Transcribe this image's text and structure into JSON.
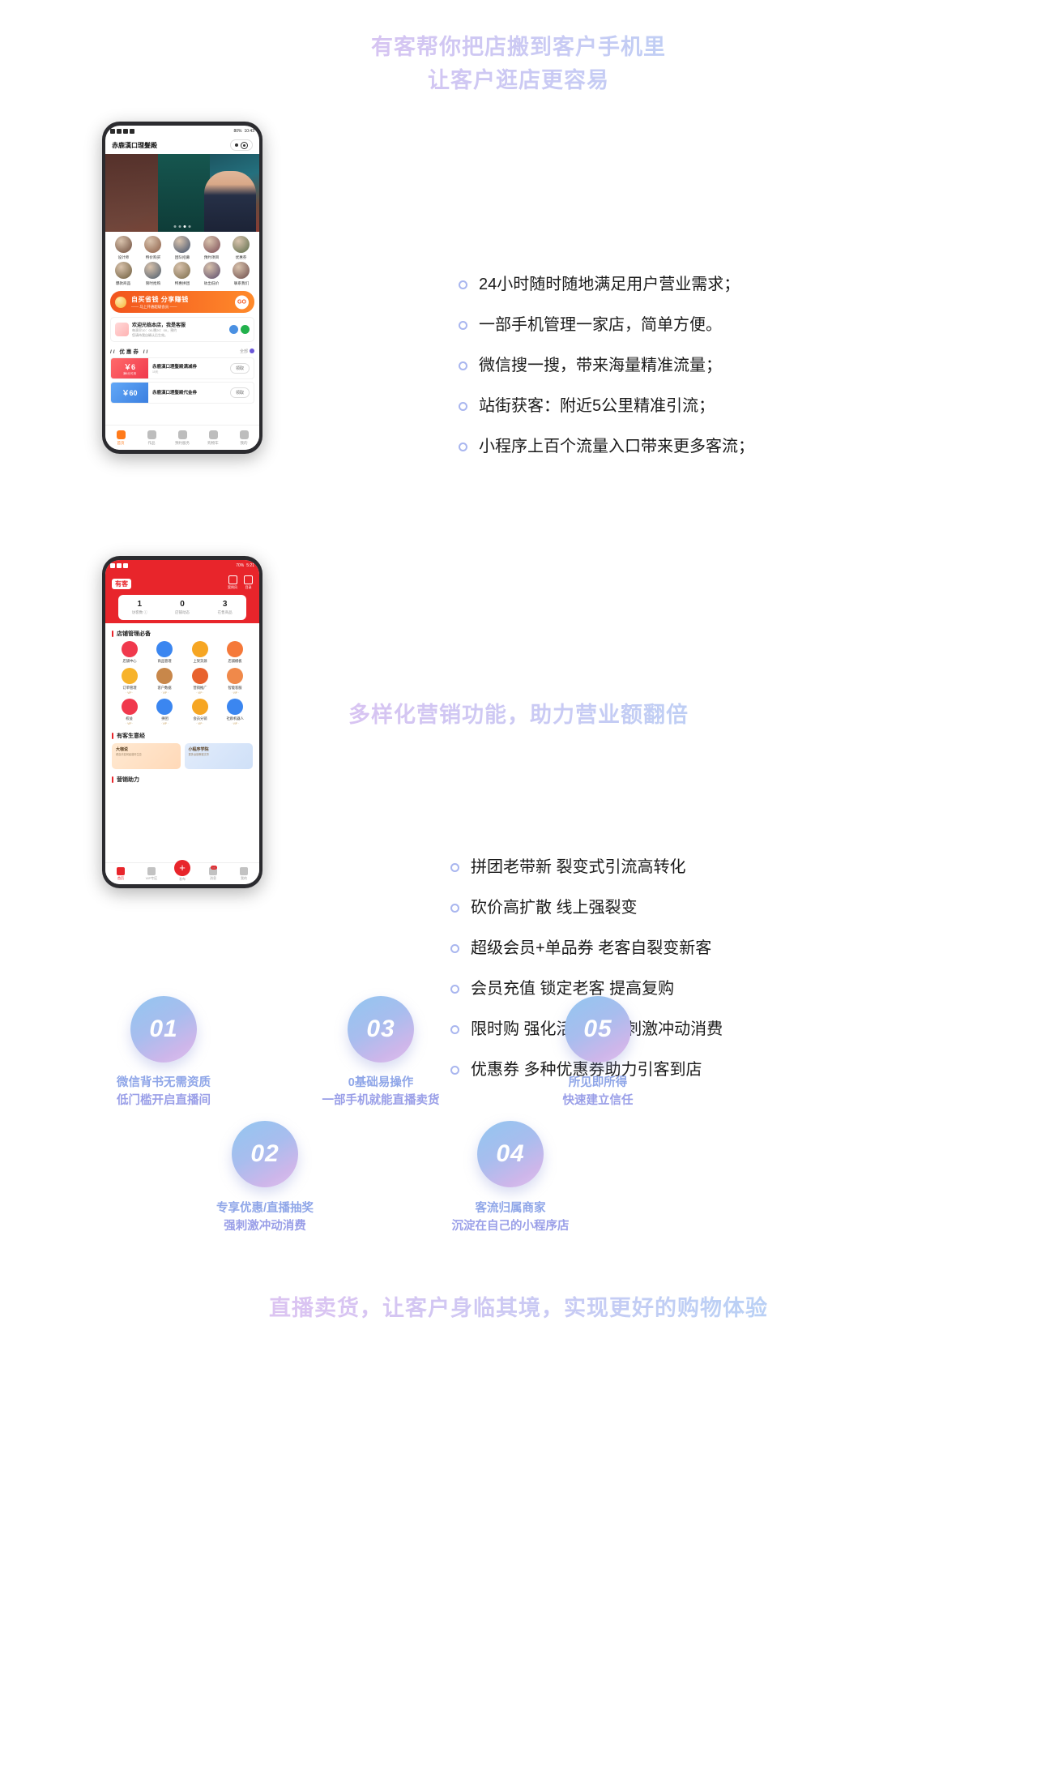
{
  "sections": [
    {
      "heading_line1": "有客帮你把店搬到客户手机里",
      "heading_line2": "让客户逛店更容易",
      "bullets": [
        "24小时随时随地满足用户营业需求；",
        "一部手机管理一家店，简单方便。",
        "微信搜一搜，带来海量精准流量；",
        "站街获客：附近5公里精准引流；",
        "小程序上百个流量入口带来更多客流；"
      ],
      "phone": {
        "status_time": "10:43",
        "status_battery": "80%",
        "shop_title": "赤鹿漢口理髮殿",
        "icon_grid": [
          {
            "label": "设计师"
          },
          {
            "label": "特价购买"
          },
          {
            "label": "团队招募"
          },
          {
            "label": "预约项目"
          },
          {
            "label": "优惠券"
          },
          {
            "label": "爆款商品"
          },
          {
            "label": "限时抢购"
          },
          {
            "label": "特惠拼团"
          },
          {
            "label": "砍出低价"
          },
          {
            "label": "联系我们"
          }
        ],
        "promo_title": "自买省钱 分享赚钱",
        "promo_sub": "—— 马上开通超级会员 ——",
        "promo_button": "GO",
        "welcome_title": "欢迎光临本店，我是客服",
        "welcome_line1": "每滴早10：00-晚20：00，预约",
        "welcome_line2": "您请待我自确认后生效。",
        "coupon_header": "// 优惠券 //",
        "coupon_more": "全部",
        "coupons": [
          {
            "amount": "￥6",
            "cond": "满6元可用",
            "title": "赤鹿漢口理髮殿满减券",
            "sub": "15天",
            "btn": "领取"
          },
          {
            "amount": "￥60",
            "cond": "",
            "title": "赤鹿漢口理髮殿代金券",
            "sub": "",
            "btn": "领取"
          }
        ],
        "tabs": [
          {
            "label": "首页",
            "active": true
          },
          {
            "label": "作品",
            "active": false
          },
          {
            "label": "预约服务",
            "active": false
          },
          {
            "label": "购物车",
            "active": false
          },
          {
            "label": "我的",
            "active": false
          }
        ]
      }
    },
    {
      "heading_line1": "多样化营销功能，助力营业额翻倍",
      "bullets": [
        "拼团老带新 裂变式引流高转化",
        "砍价高扩散 线上强裂变",
        "超级会员+单品券 老客自裂变新客",
        "会员充值 锁定老客 提高复购",
        "限时购 强化活动氛围 刺激冲动消费",
        "优惠券 多种优惠券助力引客到店"
      ],
      "phone": {
        "status_time": "5:21",
        "status_battery": "70%",
        "brand": "有客",
        "head_actions": [
          {
            "label": "案例风"
          },
          {
            "label": "目录"
          }
        ],
        "stats": [
          {
            "value": "1",
            "label": "访客数 ⓘ"
          },
          {
            "value": "0",
            "label": "店铺动态"
          },
          {
            "value": "3",
            "label": "在售商品"
          }
        ],
        "section1_title": "店铺管理必备",
        "tools": [
          {
            "label": "店铺中心",
            "color": "#f0394d",
            "vip": ""
          },
          {
            "label": "商品管理",
            "color": "#3b86f0",
            "vip": ""
          },
          {
            "label": "上架货源",
            "color": "#f6a623",
            "vip": ""
          },
          {
            "label": "店铺模板",
            "color": "#f5793a",
            "vip": ""
          },
          {
            "label": "订单管理",
            "color": "#f7b32b",
            "vip": "· VIP ·"
          },
          {
            "label": "客户数据",
            "color": "#c8874a",
            "vip": "· VIP ·"
          },
          {
            "label": "营销推广",
            "color": "#e8622e",
            "vip": "· VIP ·"
          },
          {
            "label": "智能客服",
            "color": "#f0894a",
            "vip": "· VIP ·"
          },
          {
            "label": "权益",
            "color": "#f0394d",
            "vip": "· VIP ·"
          },
          {
            "label": "拼团",
            "color": "#3b86f0",
            "vip": "· VIP ·"
          },
          {
            "label": "会员分销",
            "color": "#f6a623",
            "vip": "· VIP ·"
          },
          {
            "label": "社群机器人",
            "color": "#3b86f0",
            "vip": "· VIP ·"
          }
        ],
        "section2_title": "有客生意经",
        "cards": [
          {
            "title": "大咖说",
            "sub": "看高手如何经营好生意"
          },
          {
            "title": "小程序学院",
            "sub": "更多运营教程文章"
          }
        ],
        "section3_title": "营销助力",
        "tabs": [
          {
            "label": "首页",
            "active": true,
            "badge": ""
          },
          {
            "label": "VIP专区",
            "active": false,
            "badge": ""
          },
          {
            "label": "发布",
            "active": false,
            "badge": ""
          },
          {
            "label": "消息",
            "active": false,
            "badge": "99"
          },
          {
            "label": "我的",
            "active": false,
            "badge": ""
          }
        ]
      }
    },
    {
      "heading_line1": "直播卖货，让客户身临其境，实现更好的购物体验",
      "steps": [
        {
          "num": "01",
          "line1": "微信背书无需资质",
          "line2": "低门槛开启直播间"
        },
        {
          "num": "02",
          "line1": "专享优惠/直播抽奖",
          "line2": "强刺激冲动消费"
        },
        {
          "num": "03",
          "line1": "0基础易操作",
          "line2": "一部手机就能直播卖货"
        },
        {
          "num": "04",
          "line1": "客流归属商家",
          "line2": "沉淀在自己的小程序店"
        },
        {
          "num": "05",
          "line1": "所见即所得",
          "line2": "快速建立信任"
        }
      ]
    }
  ],
  "colors": {
    "gradient_start": "#e9c6ef",
    "gradient_end": "#aacdf7",
    "bullet_ring": "#a9b6ef",
    "text_dark": "#1b1b1b",
    "brand_red": "#e8252b",
    "promo_orange": "#f2541d",
    "caption_blue": "#8fa6e8"
  }
}
